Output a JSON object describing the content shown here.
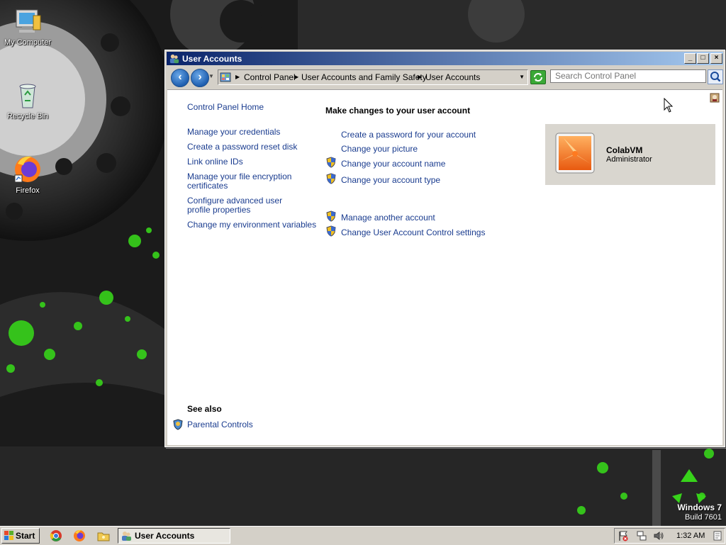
{
  "desktop": {
    "icons": [
      {
        "label": "My Computer",
        "icon": "my-computer-icon"
      },
      {
        "label": "Recycle Bin",
        "icon": "recycle-bin-icon"
      },
      {
        "label": "Firefox",
        "icon": "firefox-icon"
      }
    ],
    "watermark": {
      "line1": "Windows 7",
      "line2": "Build 7601"
    }
  },
  "window": {
    "title": "User Accounts",
    "breadcrumb": [
      "Control Panel",
      "User Accounts and Family Safety",
      "User Accounts"
    ],
    "search_placeholder": "Search Control Panel",
    "sidebar": {
      "home": "Control Panel Home",
      "links": [
        "Manage your credentials",
        "Create a password reset disk",
        "Link online IDs",
        "Manage your file encryption certificates",
        "Configure advanced user profile properties",
        "Change my environment variables"
      ],
      "see_also_title": "See also",
      "see_also_links": [
        "Parental Controls"
      ]
    },
    "main": {
      "heading": "Make changes to your user account",
      "actions": [
        {
          "label": "Create a password for your account",
          "shield": false
        },
        {
          "label": "Change your picture",
          "shield": false
        },
        {
          "label": "Change your account name",
          "shield": true
        },
        {
          "label": "Change your account type",
          "shield": true
        }
      ],
      "other_actions": [
        {
          "label": "Manage another account",
          "shield": true
        },
        {
          "label": "Change User Account Control settings",
          "shield": true
        }
      ]
    },
    "account": {
      "name": "ColabVM",
      "role": "Administrator"
    }
  },
  "taskbar": {
    "start_label": "Start",
    "quick_launch": [
      "chrome-icon",
      "firefox-icon",
      "folder-icon"
    ],
    "task_button": "User Accounts",
    "clock": "1:32 AM"
  },
  "colors": {
    "link": "#1a3c8f",
    "title_start": "#0a246a",
    "title_end": "#a6caf0",
    "chrome": "#d4d0c8"
  }
}
